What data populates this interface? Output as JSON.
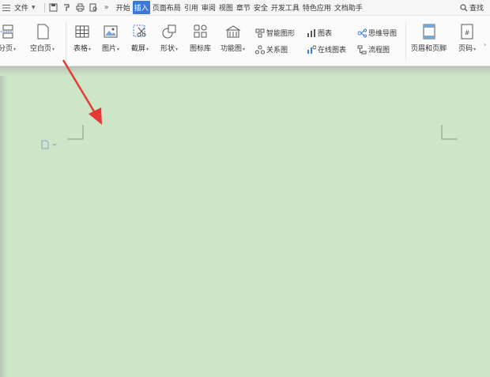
{
  "menubar": {
    "file_label": "文件",
    "more_label": "»",
    "tabs": [
      {
        "label": "开始",
        "active": false
      },
      {
        "label": "插入",
        "active": true
      },
      {
        "label": "页面布局",
        "active": false
      },
      {
        "label": "引用",
        "active": false
      },
      {
        "label": "审阅",
        "active": false
      },
      {
        "label": "视图",
        "active": false
      },
      {
        "label": "章节",
        "active": false
      },
      {
        "label": "安全",
        "active": false
      },
      {
        "label": "开发工具",
        "active": false
      },
      {
        "label": "特色应用",
        "active": false
      },
      {
        "label": "文档助手",
        "active": false
      }
    ],
    "search_label": "查找"
  },
  "ribbon": {
    "page_break": "分页",
    "blank_page": "空白页",
    "table": "表格",
    "picture": "图片",
    "screenshot": "截屏",
    "shapes": "形状",
    "icon_library": "图标库",
    "function_chart": "功能图",
    "smart_art": "智能图形",
    "chart": "图表",
    "relation_chart": "关系图",
    "online_chart": "在线图表",
    "mind_map": "思维导图",
    "flowchart": "流程图",
    "header_footer": "页眉和页脚",
    "page_number": "页码"
  },
  "colors": {
    "accent": "#3b78d8",
    "document_bg": "#cde6c7",
    "arrow": "#e53935"
  }
}
